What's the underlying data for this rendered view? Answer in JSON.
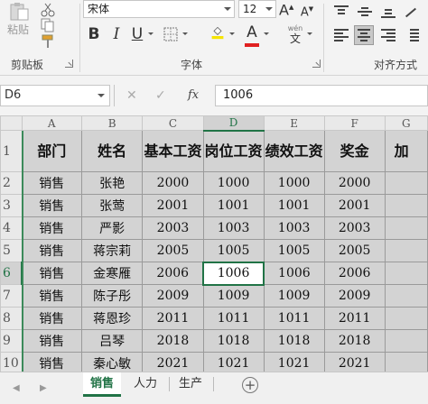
{
  "ribbon": {
    "clipboard": {
      "paste_label": "粘贴",
      "group_label": "剪贴板"
    },
    "font": {
      "family": "宋体",
      "size": "12",
      "grow_glyph": "A",
      "shrink_glyph": "A",
      "bold": "B",
      "italic": "I",
      "underline": "U",
      "font_color_glyph": "A",
      "wen_top": "wén",
      "wen_bottom": "文",
      "group_label": "字体",
      "fill_color": "#f5e400",
      "font_color": "#e02020"
    },
    "alignment": {
      "group_label": "对齐方式"
    }
  },
  "formula_bar": {
    "name_box": "D6",
    "cancel": "✕",
    "enter": "✓",
    "fx": "fx",
    "value": "1006"
  },
  "sheet": {
    "columns": [
      "A",
      "B",
      "C",
      "D",
      "E",
      "F",
      "G"
    ],
    "rows": [
      "1",
      "2",
      "3",
      "4",
      "5",
      "6",
      "7",
      "8",
      "9",
      "10"
    ],
    "header_cells": [
      "部门",
      "姓名",
      "基本工资",
      "岗位工资",
      "绩效工资",
      "奖金",
      "加"
    ],
    "data": [
      [
        "销售",
        "张艳",
        "2000",
        "1000",
        "1000",
        "2000",
        ""
      ],
      [
        "销售",
        "张莺",
        "2001",
        "1001",
        "1001",
        "2001",
        ""
      ],
      [
        "销售",
        "严影",
        "2003",
        "1003",
        "1003",
        "2003",
        ""
      ],
      [
        "销售",
        "蒋宗莉",
        "2005",
        "1005",
        "1005",
        "2005",
        ""
      ],
      [
        "销售",
        "金寒雁",
        "2006",
        "1006",
        "1006",
        "2006",
        ""
      ],
      [
        "销售",
        "陈子彤",
        "2009",
        "1009",
        "1009",
        "2009",
        ""
      ],
      [
        "销售",
        "蒋恩珍",
        "2011",
        "1011",
        "1011",
        "2011",
        ""
      ],
      [
        "销售",
        "吕琴",
        "2018",
        "1018",
        "1018",
        "2018",
        ""
      ],
      [
        "销售",
        "秦心敏",
        "2021",
        "1021",
        "1021",
        "2021",
        ""
      ]
    ],
    "selected_cell": "D6"
  },
  "tabs": {
    "items": [
      "销售",
      "人力",
      "生产"
    ],
    "active": "销售",
    "add": "+"
  },
  "colors": {
    "accent": "#217346",
    "cell_fill": "#d3d3d3"
  }
}
